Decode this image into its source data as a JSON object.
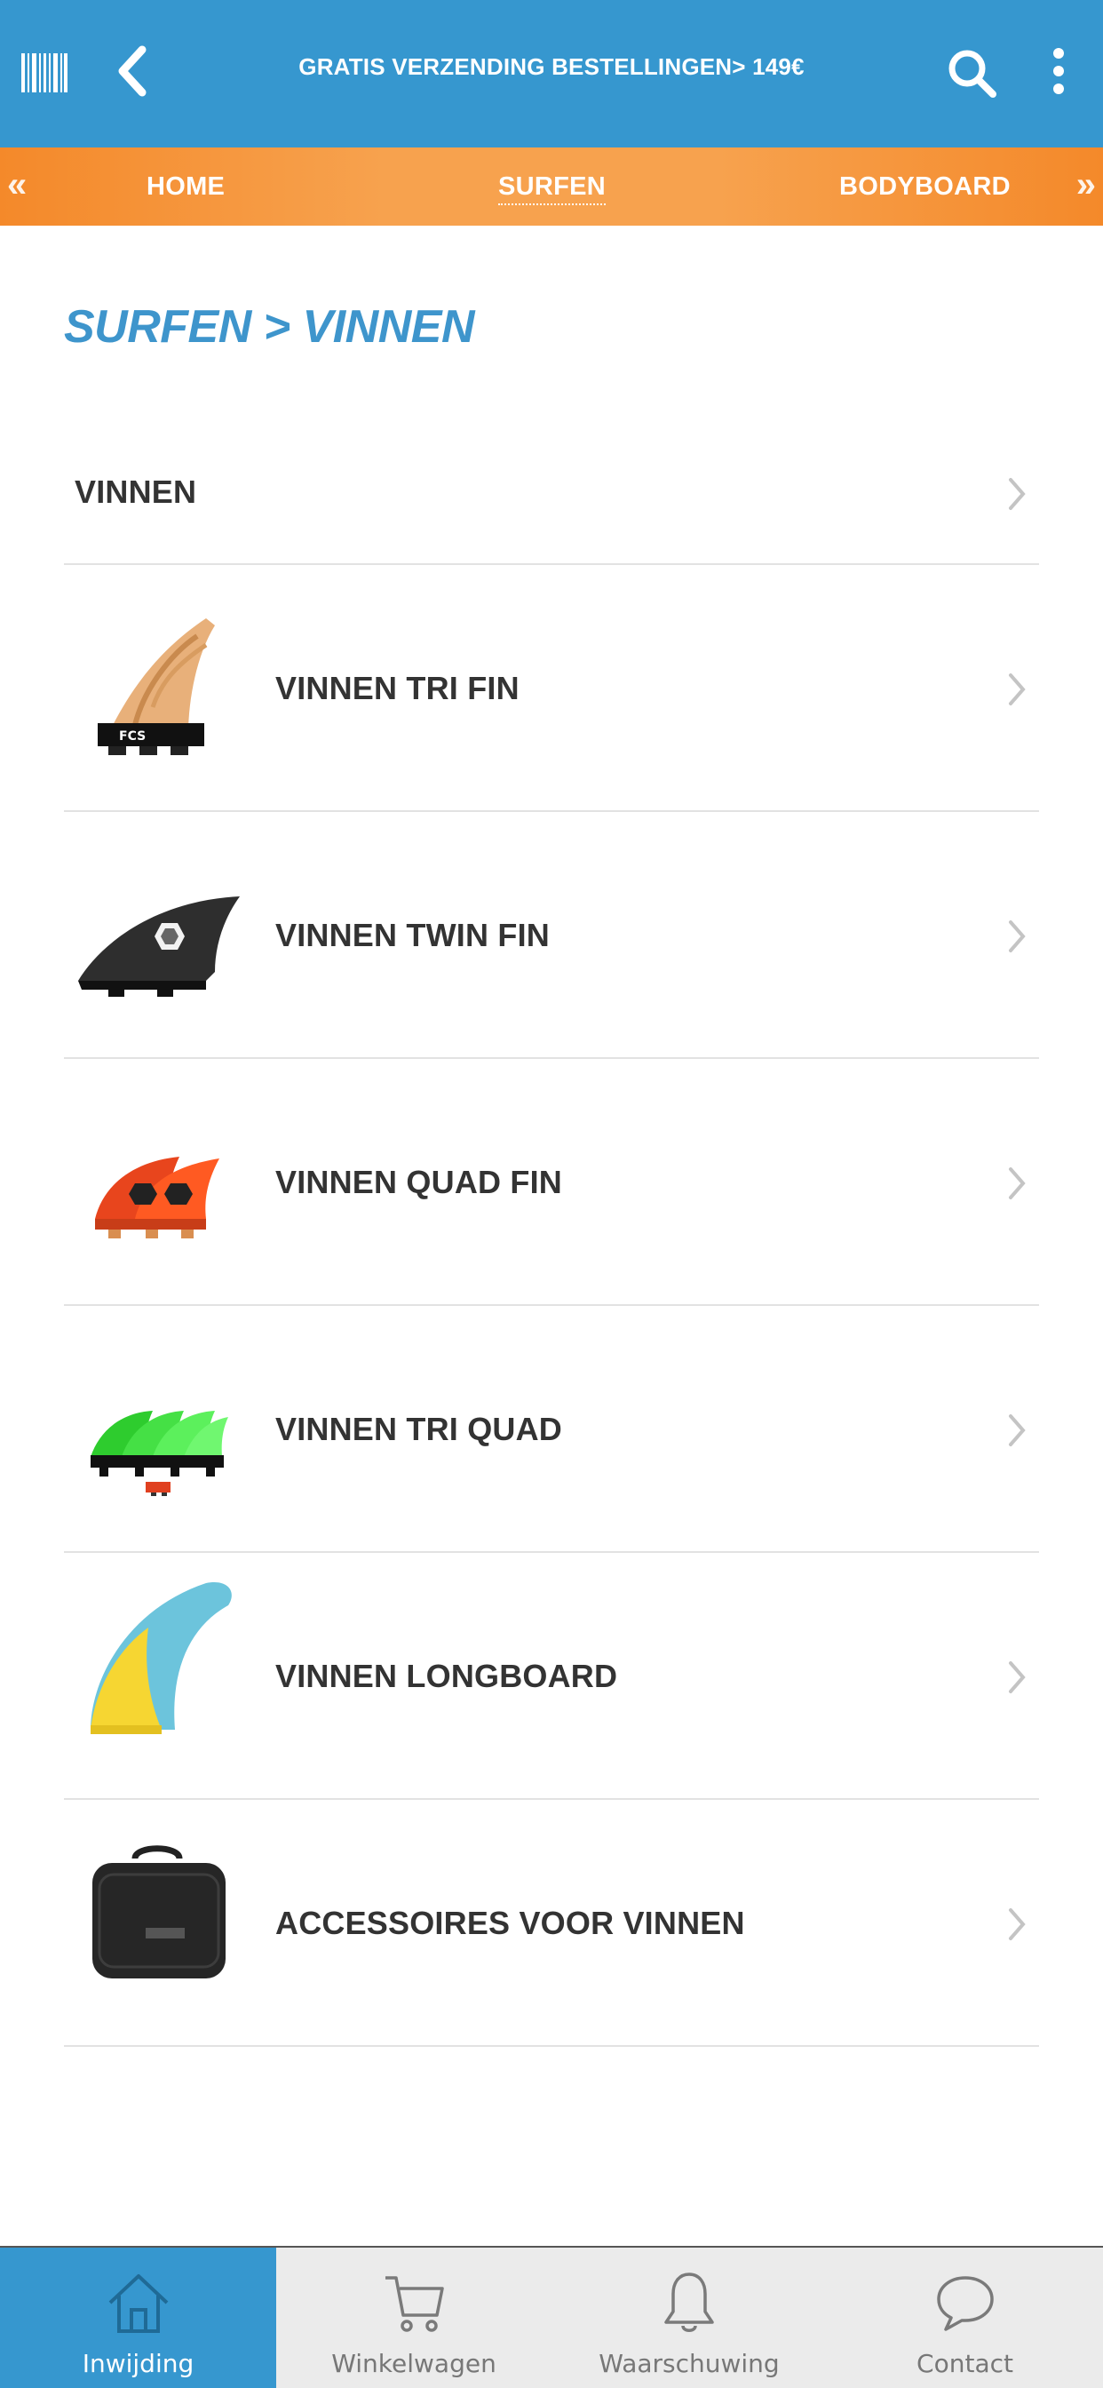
{
  "topbar": {
    "promo_text": "GRATIS VERZENDING BESTELLINGEN> 149€",
    "icons": [
      "barcode-icon",
      "back-arrow-icon",
      "search-icon",
      "more-vertical-icon"
    ]
  },
  "catnav": {
    "left_arrow": "«",
    "right_arrow": "»",
    "items": [
      "HOME",
      "SURFEN",
      "BODYBOARD"
    ],
    "active": "SURFEN"
  },
  "page": {
    "title": "SURFEN > VINNEN"
  },
  "list": {
    "items": [
      {
        "label": "VINNEN",
        "image": "none"
      },
      {
        "label": "VINNEN TRI FIN",
        "image": "tri-fin-image"
      },
      {
        "label": "VINNEN TWIN FIN",
        "image": "twin-fin-image"
      },
      {
        "label": "VINNEN QUAD FIN",
        "image": "quad-fin-image"
      },
      {
        "label": "VINNEN TRI QUAD",
        "image": "tri-quad-image"
      },
      {
        "label": "VINNEN LONGBOARD",
        "image": "longboard-fin-image"
      },
      {
        "label": "ACCESSOIRES VOOR VINNEN",
        "image": "fin-bag-image"
      }
    ]
  },
  "tabbar": {
    "tabs": [
      {
        "label": "Inwijding",
        "icon": "home-icon",
        "active": true
      },
      {
        "label": "Winkelwagen",
        "icon": "cart-icon",
        "active": false
      },
      {
        "label": "Waarschuwing",
        "icon": "bell-icon",
        "active": false
      },
      {
        "label": "Contact",
        "icon": "chat-bubble-icon",
        "active": false
      }
    ]
  },
  "colors": {
    "topbar": "#3697cf",
    "catnav": "#f7a24e",
    "title": "#3e95cc",
    "active_tab": "#3697cf"
  }
}
